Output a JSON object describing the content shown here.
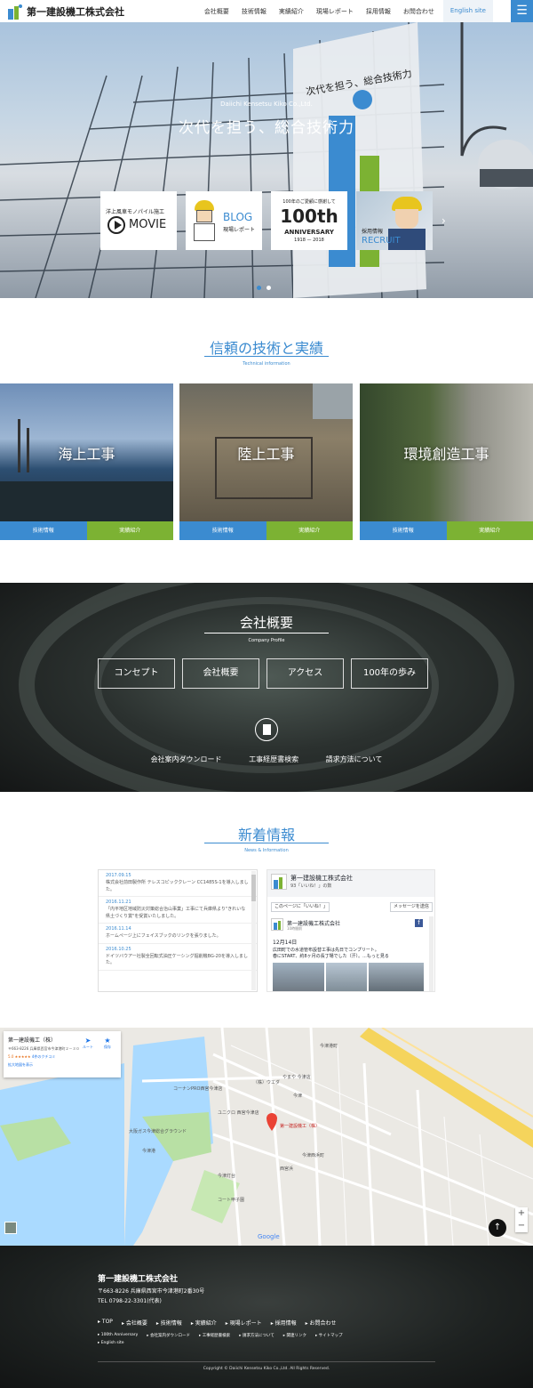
{
  "header": {
    "logo_text": "第一建設機工株式会社",
    "nav": [
      "会社概要",
      "技術情報",
      "実績紹介",
      "現場レポート",
      "採用情報",
      "お問合わせ"
    ],
    "english": "English site",
    "menu_icon": "☰"
  },
  "hero": {
    "subtitle": "Daiichi Kensetsu Kiko Co.,Ltd.",
    "title": "次代を担う、総合技術力",
    "banner_text": "次代を担う、総合技術力",
    "cards": [
      {
        "top": "洋上風車モノパイル施工",
        "main": "MOVIE"
      },
      {
        "main": "BLOG",
        "sub": "現場レポート"
      },
      {
        "top": "100年のご愛顧に感謝して",
        "main": "100th",
        "sub": "ANNIVERSARY",
        "years": "1918 — 2018"
      },
      {
        "top": "採用情報",
        "main": "RECRUIT"
      }
    ]
  },
  "tech": {
    "title": "信頼の技術と実績",
    "subtitle": "Technical information",
    "cards": [
      {
        "label": "海上工事",
        "btn1": "技術情報",
        "btn2": "実績紹介"
      },
      {
        "label": "陸上工事",
        "btn1": "技術情報",
        "btn2": "実績紹介"
      },
      {
        "label": "環境創造工事",
        "btn1": "技術情報",
        "btn2": "実績紹介"
      }
    ]
  },
  "company": {
    "title": "会社概要",
    "subtitle": "Company Profile",
    "buttons": [
      "コンセプト",
      "会社概要",
      "アクセス",
      "100年の歩み"
    ],
    "links": [
      "会社案内ダウンロード",
      "工事経歴書検索",
      "請求方法について"
    ]
  },
  "news": {
    "title": "新着情報",
    "subtitle": "News & Information",
    "items": [
      {
        "date": "2017.09.15",
        "text": "株式会社前田製作所 テレスコピッククレーン CC1485S-1を導入しました。"
      },
      {
        "date": "2016.11.21",
        "text": "「内平地区地域防災対策総合治山事業」工事にて兵庫県より\"きれいな県土づくり賞\"を受賞いたしました。"
      },
      {
        "date": "2016.11.14",
        "text": "ホームページ上にフェイスブックのリンクを張りました。"
      },
      {
        "date": "2016.10.25",
        "text": "ドイツバウアー社製全回転式油圧ケーシング掘削機BG-20を導入しました。"
      }
    ],
    "fb": {
      "page_name": "第一建設機工株式会社",
      "likes": "93「いいね！」の数",
      "like_btn": "このページに「いいね！」",
      "msg_btn": "メッセージを送信",
      "post_author": "第一建設機工株式会社",
      "post_time": "10時間前",
      "post_date": "12月14日",
      "post_text": "広田町での水道管布設替工事は先日でコンプリート。",
      "post_text2": "春にSTART、約8ヶ月の長丁場でした（汗）。...もっと見る"
    }
  },
  "map": {
    "place_name": "第一建設機工（株）",
    "address": "〒663-8226 兵庫県西宮市今津港町２－３０",
    "rating": "5.0",
    "stars": "★★★★★",
    "reviews": "4件のクチコミ",
    "enlarge": "拡大地図を表示",
    "route": "ルート",
    "save": "保存",
    "pin_label": "第一建設機工（株）",
    "labels": [
      "今津港町",
      "今津",
      "西宮浜",
      "コーナンPRO西宮今津店",
      "ユニクロ 西宮今津店",
      "やまや 今津店",
      "（株）ウエダ",
      "今津西浜町",
      "大阪ガス今津総合グラウンド",
      "今津灯台",
      "今津港",
      "コート甲子園"
    ],
    "google": "Google",
    "zoom_in": "+",
    "zoom_out": "−"
  },
  "footer": {
    "company": "第一建設機工株式会社",
    "address": "〒663-8226 兵庫県西宮市今津港町2番30号",
    "tel": "TEL 0798-22-3301(代表)",
    "links1": [
      "TOP",
      "会社概要",
      "技術情報",
      "実績紹介",
      "現場レポート",
      "採用情報",
      "お問合わせ"
    ],
    "links2": [
      "100th Anniversary",
      "会社案内ダウンロード",
      "工事経歴書検索",
      "請求方法について",
      "関連リンク",
      "サイトマップ"
    ],
    "links3": [
      "English site"
    ],
    "copyright": "Copyright © Daiichi Kensetsu Kiko Co.,Ltd. All Rights Reserved.",
    "top_icon": "↑"
  },
  "colors": {
    "accent": "#3b8bd0",
    "green": "#7cb233"
  }
}
